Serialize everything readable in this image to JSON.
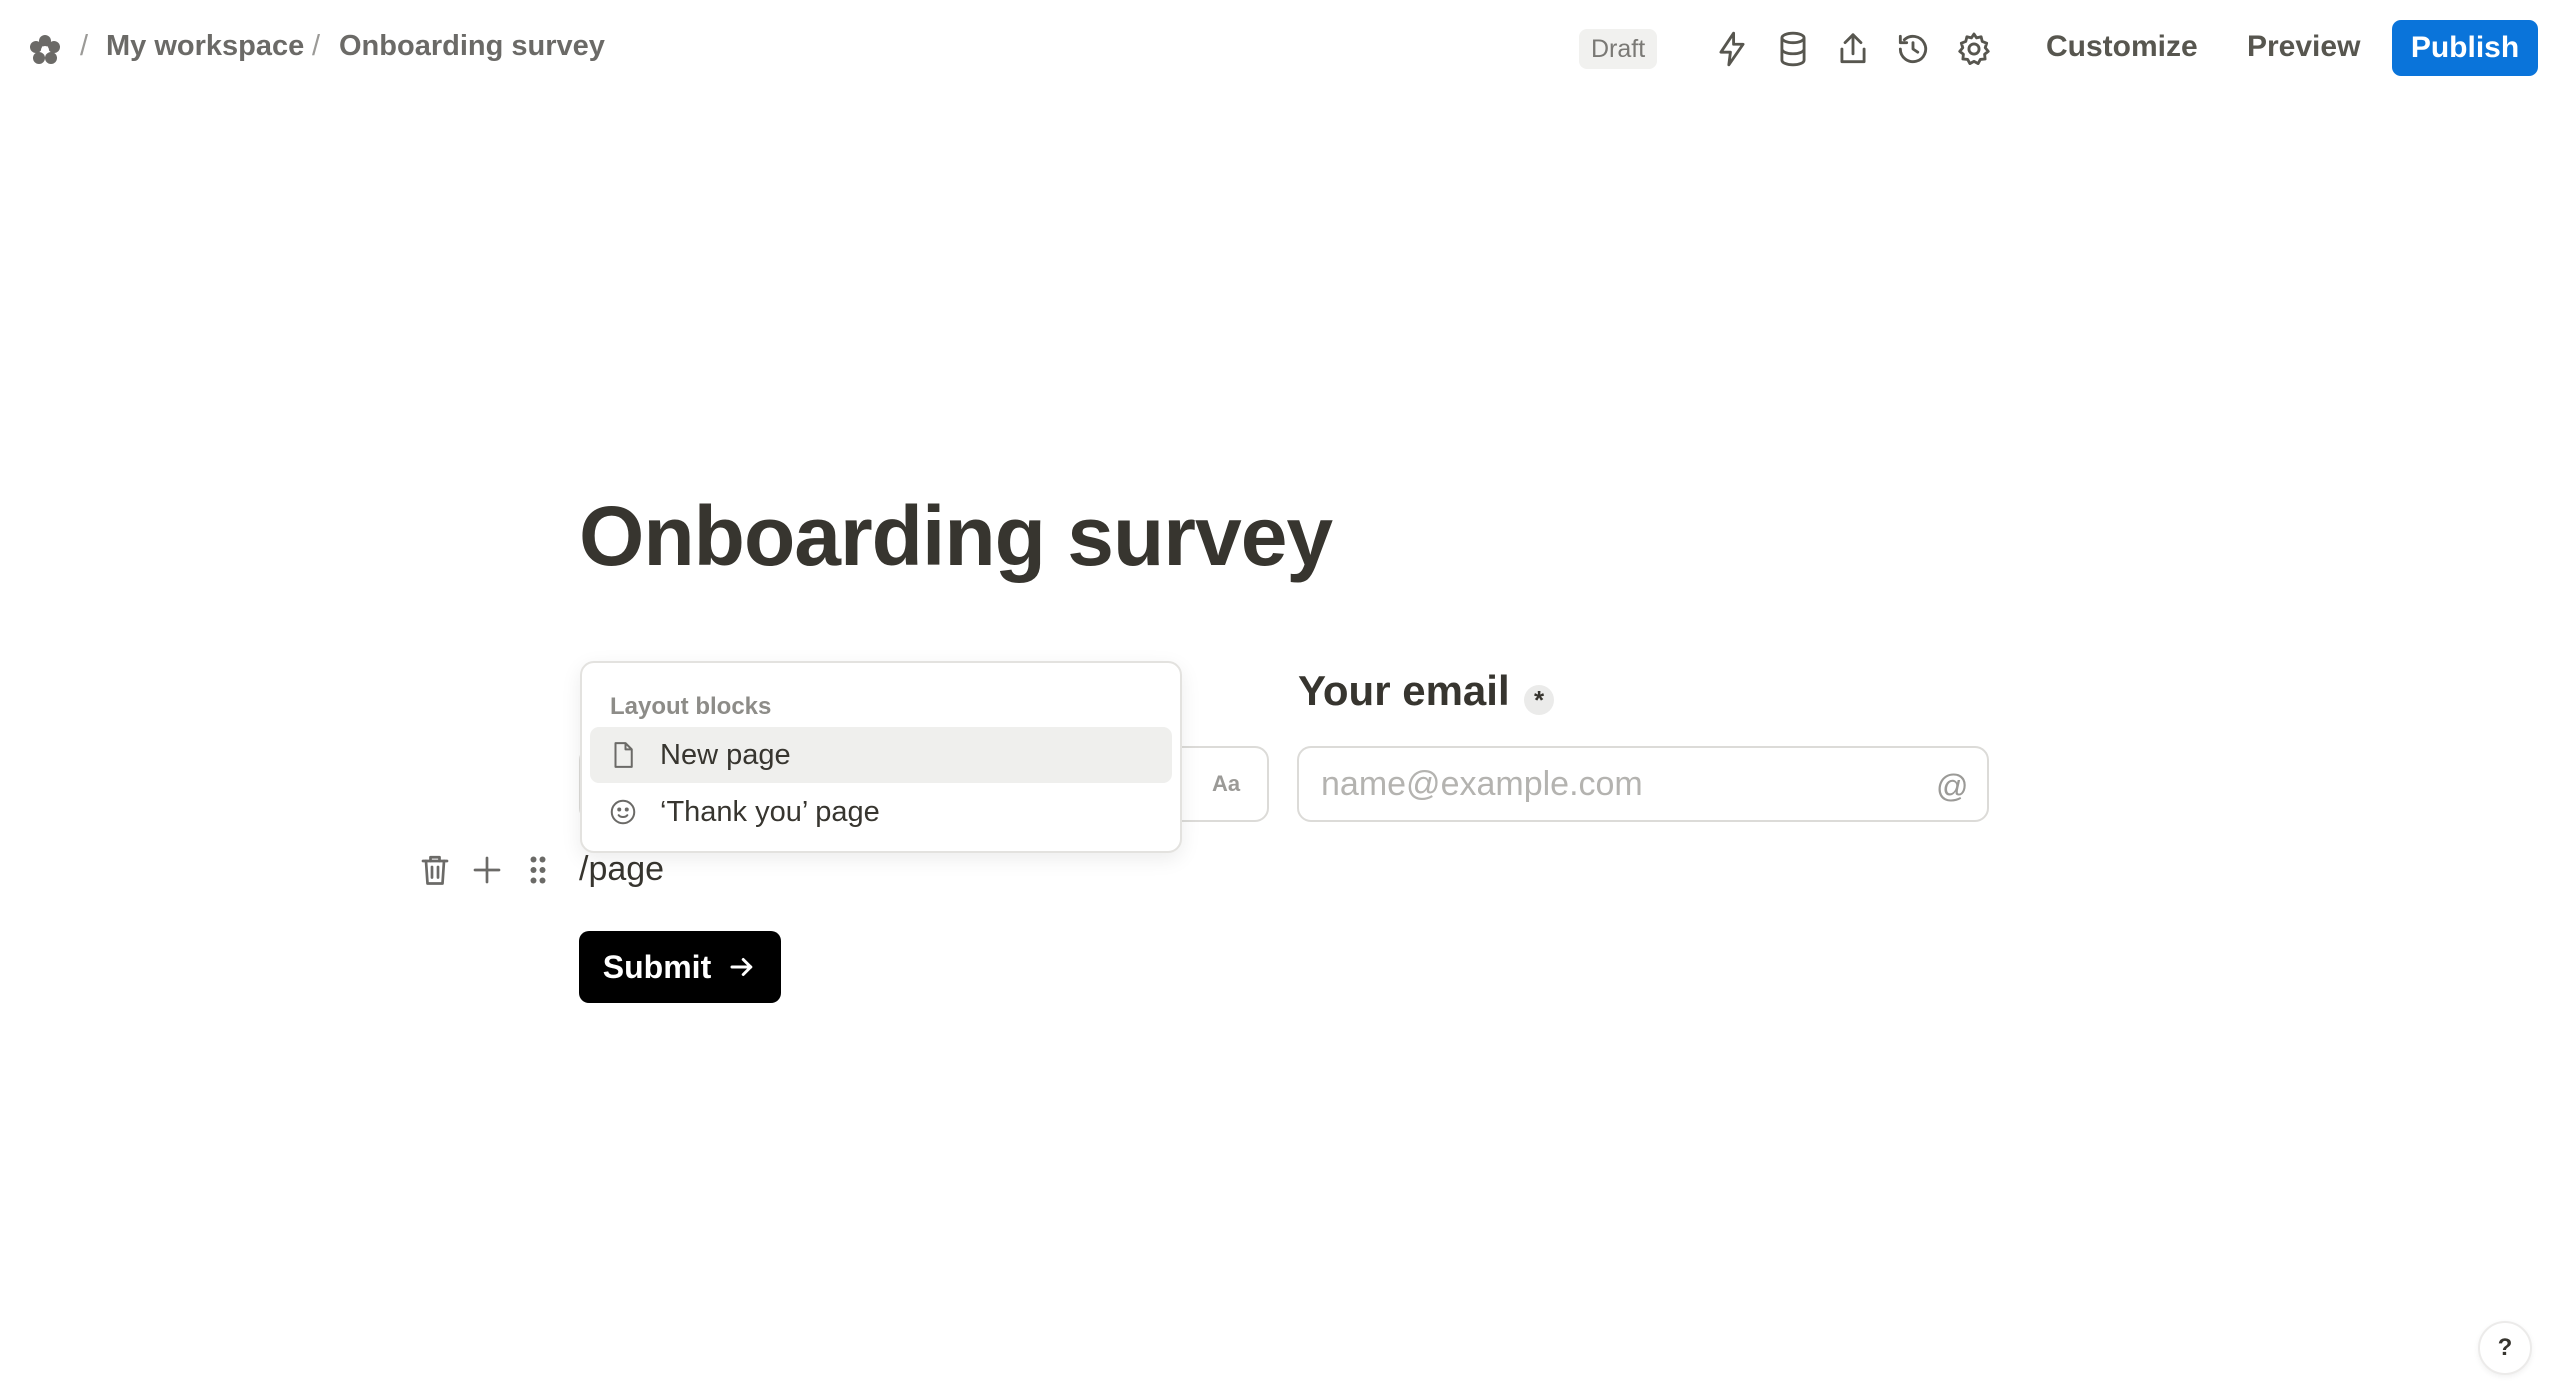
{
  "breadcrumb": {
    "separator": "/",
    "workspace": "My workspace",
    "form": "Onboarding survey"
  },
  "status": {
    "draft_label": "Draft"
  },
  "toolbar": {
    "icons": [
      "lightning-icon",
      "database-icon",
      "share-icon",
      "history-icon",
      "settings-icon"
    ],
    "customize_label": "Customize",
    "preview_label": "Preview",
    "publish_label": "Publish"
  },
  "form": {
    "title": "Onboarding survey",
    "name_field": {
      "type_hint": "Aa"
    },
    "email_field": {
      "label": "Your email",
      "required_mark": "*",
      "placeholder": "name@example.com",
      "type_hint": "@"
    },
    "slash_command_text": "/page",
    "submit_label": "Submit",
    "submit_arrow": "→"
  },
  "slash_menu": {
    "header": "Layout blocks",
    "items": [
      {
        "label": "New page",
        "icon": "page-icon",
        "active": true
      },
      {
        "label": "‘Thank you’ page",
        "icon": "smiley-icon",
        "active": false
      }
    ]
  },
  "help": {
    "label": "?"
  },
  "colors": {
    "accent": "#0a74da",
    "submit_bg": "#000000",
    "text": "#37352f"
  }
}
